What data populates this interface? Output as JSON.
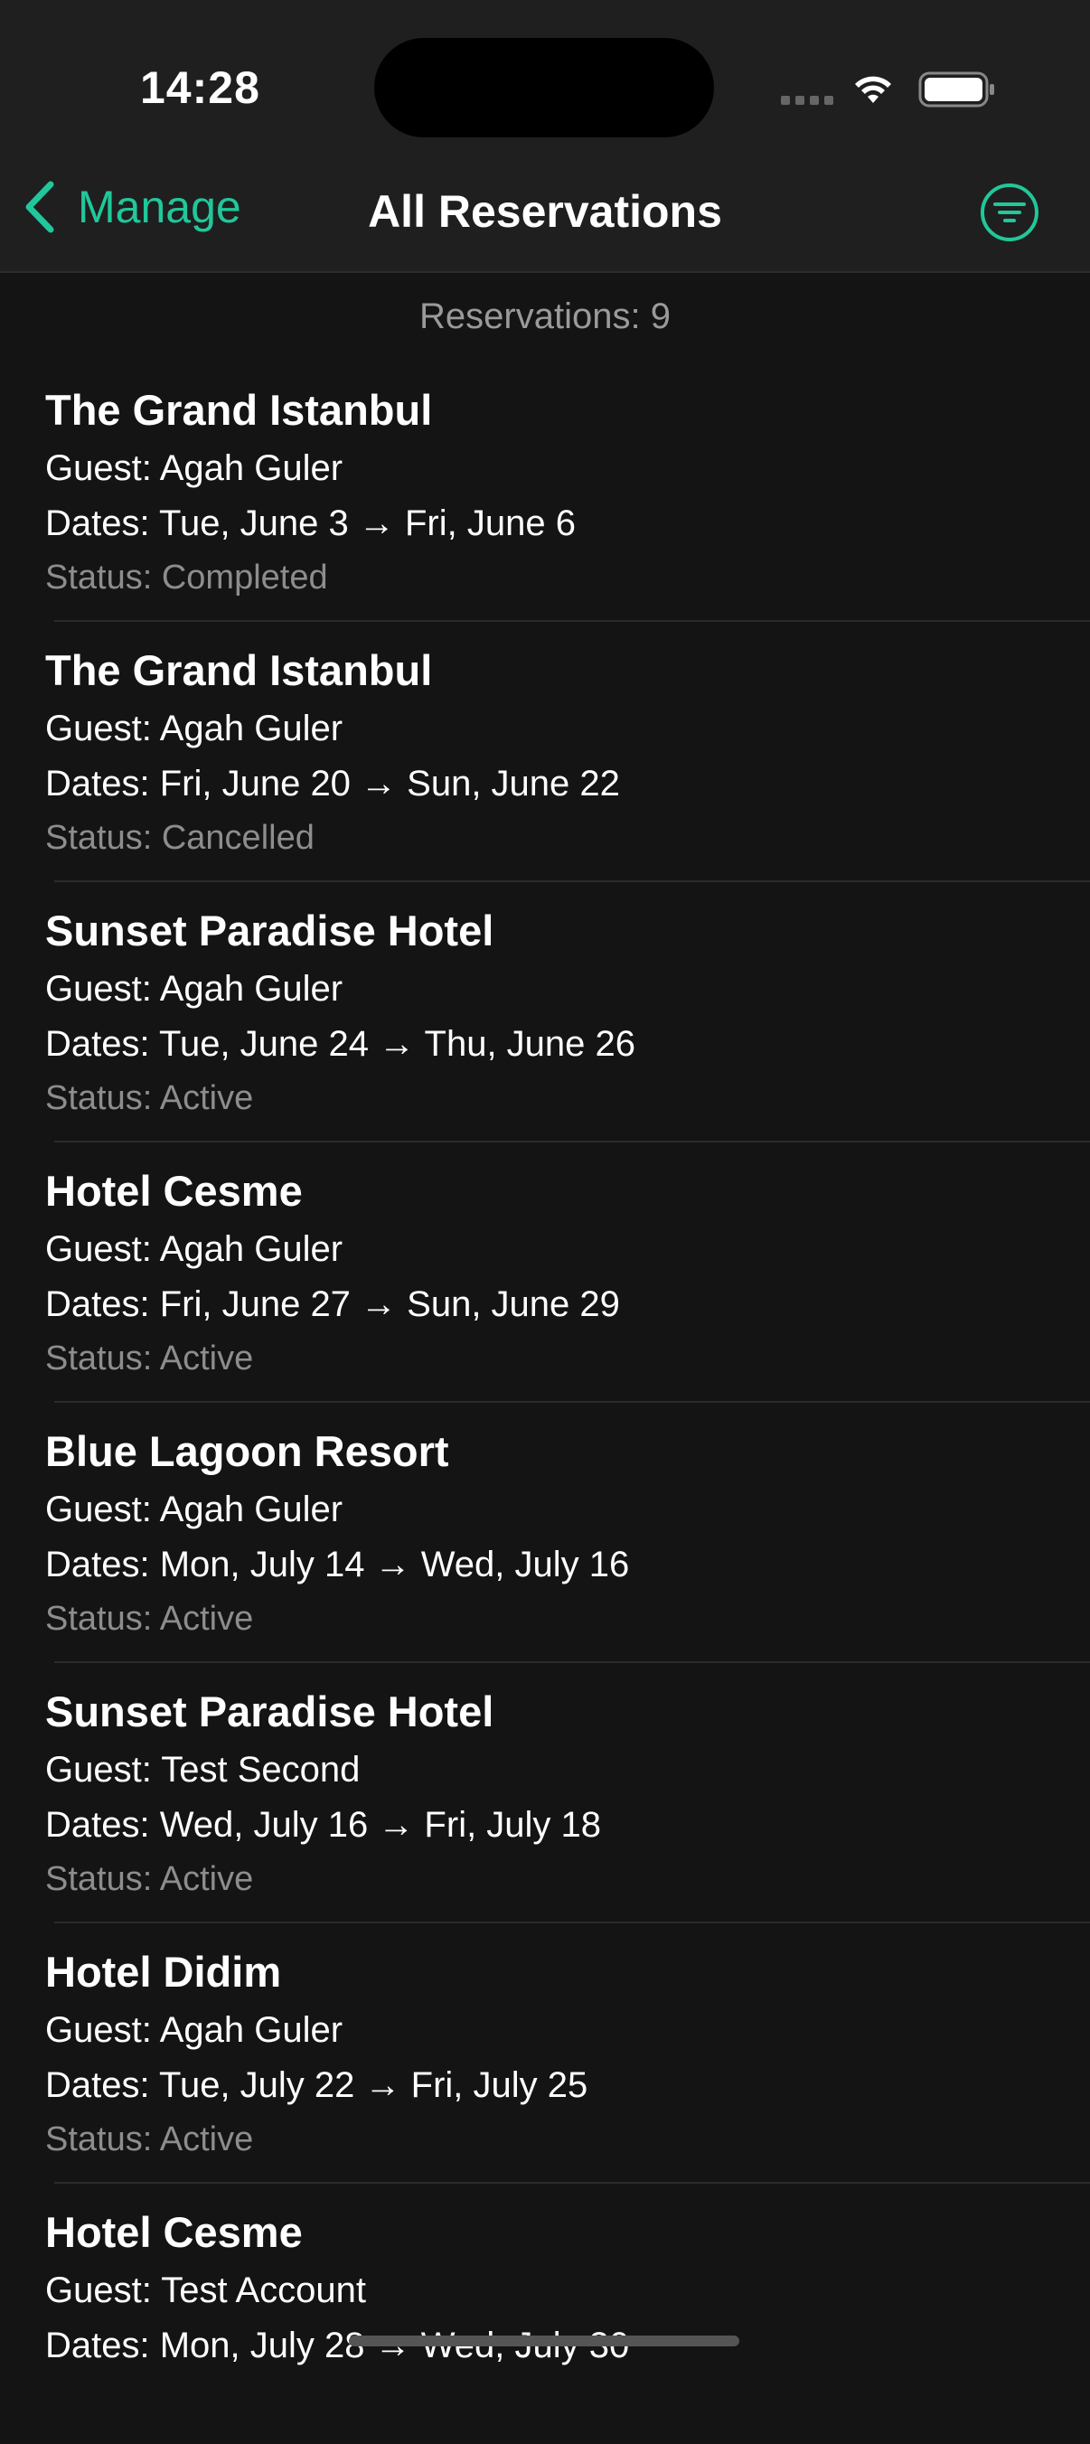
{
  "status_bar": {
    "time": "14:28"
  },
  "nav": {
    "back_label": "Manage",
    "title": "All Reservations"
  },
  "summary": {
    "count_text": "Reservations: 9"
  },
  "reservations": [
    {
      "hotel": "The Grand Istanbul",
      "guest": "Guest: Agah Guler",
      "dates": "Dates: Tue, June 3 → Fri, June 6",
      "status": "Status: Completed"
    },
    {
      "hotel": "The Grand Istanbul",
      "guest": "Guest: Agah Guler",
      "dates": "Dates: Fri, June 20 → Sun, June 22",
      "status": "Status: Cancelled"
    },
    {
      "hotel": "Sunset Paradise Hotel",
      "guest": "Guest: Agah Guler",
      "dates": "Dates: Tue, June 24 → Thu, June 26",
      "status": "Status: Active"
    },
    {
      "hotel": "Hotel Cesme",
      "guest": "Guest: Agah Guler",
      "dates": "Dates: Fri, June 27 → Sun, June 29",
      "status": "Status: Active"
    },
    {
      "hotel": "Blue Lagoon Resort",
      "guest": "Guest: Agah Guler",
      "dates": "Dates: Mon, July 14 → Wed, July 16",
      "status": "Status: Active"
    },
    {
      "hotel": "Sunset Paradise Hotel",
      "guest": "Guest: Test Second",
      "dates": "Dates: Wed, July 16 → Fri, July 18",
      "status": "Status: Active"
    },
    {
      "hotel": "Hotel Didim",
      "guest": "Guest: Agah Guler",
      "dates": "Dates: Tue, July 22 → Fri, July 25",
      "status": "Status: Active"
    },
    {
      "hotel": "Hotel Cesme",
      "guest": "Guest: Test Account",
      "dates": "Dates: Mon, July 28 → Wed, July 30",
      "status": ""
    }
  ],
  "colors": {
    "accent": "#21c79a",
    "background": "#141414",
    "nav_background": "#1f1f1f",
    "secondary_text": "#8d8d8d"
  },
  "icons": {
    "back": "chevron-left-icon",
    "filter": "filter-circle-icon",
    "wifi": "wifi-icon",
    "battery": "battery-icon"
  }
}
